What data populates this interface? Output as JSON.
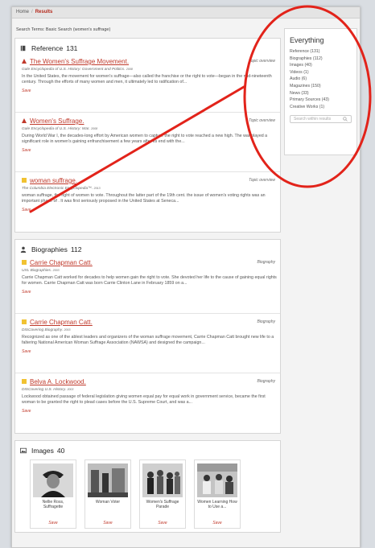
{
  "breadcrumb": {
    "home": "Home",
    "current": "Results"
  },
  "search_terms": "Search Terms: Basic Search (women's suffrage)",
  "colors": {
    "accent": "#c0392b",
    "topic_marker": "#c0392b",
    "bio_marker": "#f1c232",
    "annotation": "#e2231a"
  },
  "reference": {
    "title": "Reference",
    "count": "131",
    "items": [
      {
        "title": "The Women's Suffrage Movement.",
        "type": "Topic overview",
        "source": "Gale Encyclopedia of U.S. History: Government and Politics.",
        "year": "2008",
        "desc": "In the United States, the movement for women's suffrage—also called the franchise or the right to vote—began in the mid-nineteenth century. Through the efforts of many women and men, it ultimately led to ratification of...",
        "save": "Save",
        "marker": "triangle"
      },
      {
        "title": "Women's Suffrage.",
        "type": "Topic overview",
        "source": "Gale Encyclopedia of U.S. History: War.",
        "year": "2008",
        "desc": "During World War I, the decades-long effort by American women to capture the right to vote reached a new high. The war played a significant role in women's gaining enfranchisement a few years after its end with the...",
        "save": "Save",
        "marker": "triangle"
      },
      {
        "title": "woman suffrage.",
        "type": "Topic overview",
        "source": "The Columbia Electronic Encyclopedia™.",
        "year": "2013",
        "desc": "woman suffrage, the right of women to vote. Throughout the latter part of the 19th cent. the issue of women's voting rights was an important phase of . It was first seriously proposed in the United States at Seneca...",
        "save": "Save",
        "marker": "square"
      }
    ]
  },
  "biographies": {
    "title": "Biographies",
    "count": "112",
    "items": [
      {
        "title": "Carrie Chapman Catt.",
        "type": "Biography",
        "source": "UXL Biographies.",
        "year": "2003",
        "desc": "Carrie Chapman Catt worked for decades to help women gain the right to vote. She devoted her life to the cause of gaining equal rights for women. Carrie Chapman Catt was born Carrie Clinton Lane in February 1859 on a...",
        "save": "Save"
      },
      {
        "title": "Carrie Chapman Catt.",
        "type": "Biography",
        "source": "DISCovering Biography.",
        "year": "2003",
        "desc": "Recognized as one of the ablest leaders and organizers of the woman suffrage movement, Carrie Chapman Catt brought new life to a faltering National American Woman Suffrage Association (NAWSA) and designed the campaign...",
        "save": "Save"
      },
      {
        "title": "Belva A. Lockwood.",
        "type": "Biography",
        "source": "DISCovering U.S. History.",
        "year": "2003",
        "desc": "Lockwood obtained passage of federal legislation giving women equal pay for equal work in government service, became the first woman to be granted the right to plead cases before the U.S. Supreme Court, and was a...",
        "save": "Save"
      }
    ]
  },
  "images": {
    "title": "Images",
    "count": "40",
    "items": [
      {
        "caption": "Nellie Ross, Suffragette",
        "save": "Save"
      },
      {
        "caption": "Woman Voter",
        "save": "Save"
      },
      {
        "caption": "Women's Suffrage Parade",
        "save": "Save"
      },
      {
        "caption": "Women Learning How to Use a...",
        "save": "Save"
      }
    ]
  },
  "sidebar": {
    "title": "Everything",
    "items": [
      "Reference (131)",
      "Biographies (112)",
      "Images (40)",
      "Videos (1)",
      "Audio (6)",
      "Magazines (150)",
      "News (33)",
      "Primary Sources (43)",
      "Creative Works (1)"
    ],
    "search_placeholder": "Search within results",
    "search_icon": "magnifier-icon"
  }
}
